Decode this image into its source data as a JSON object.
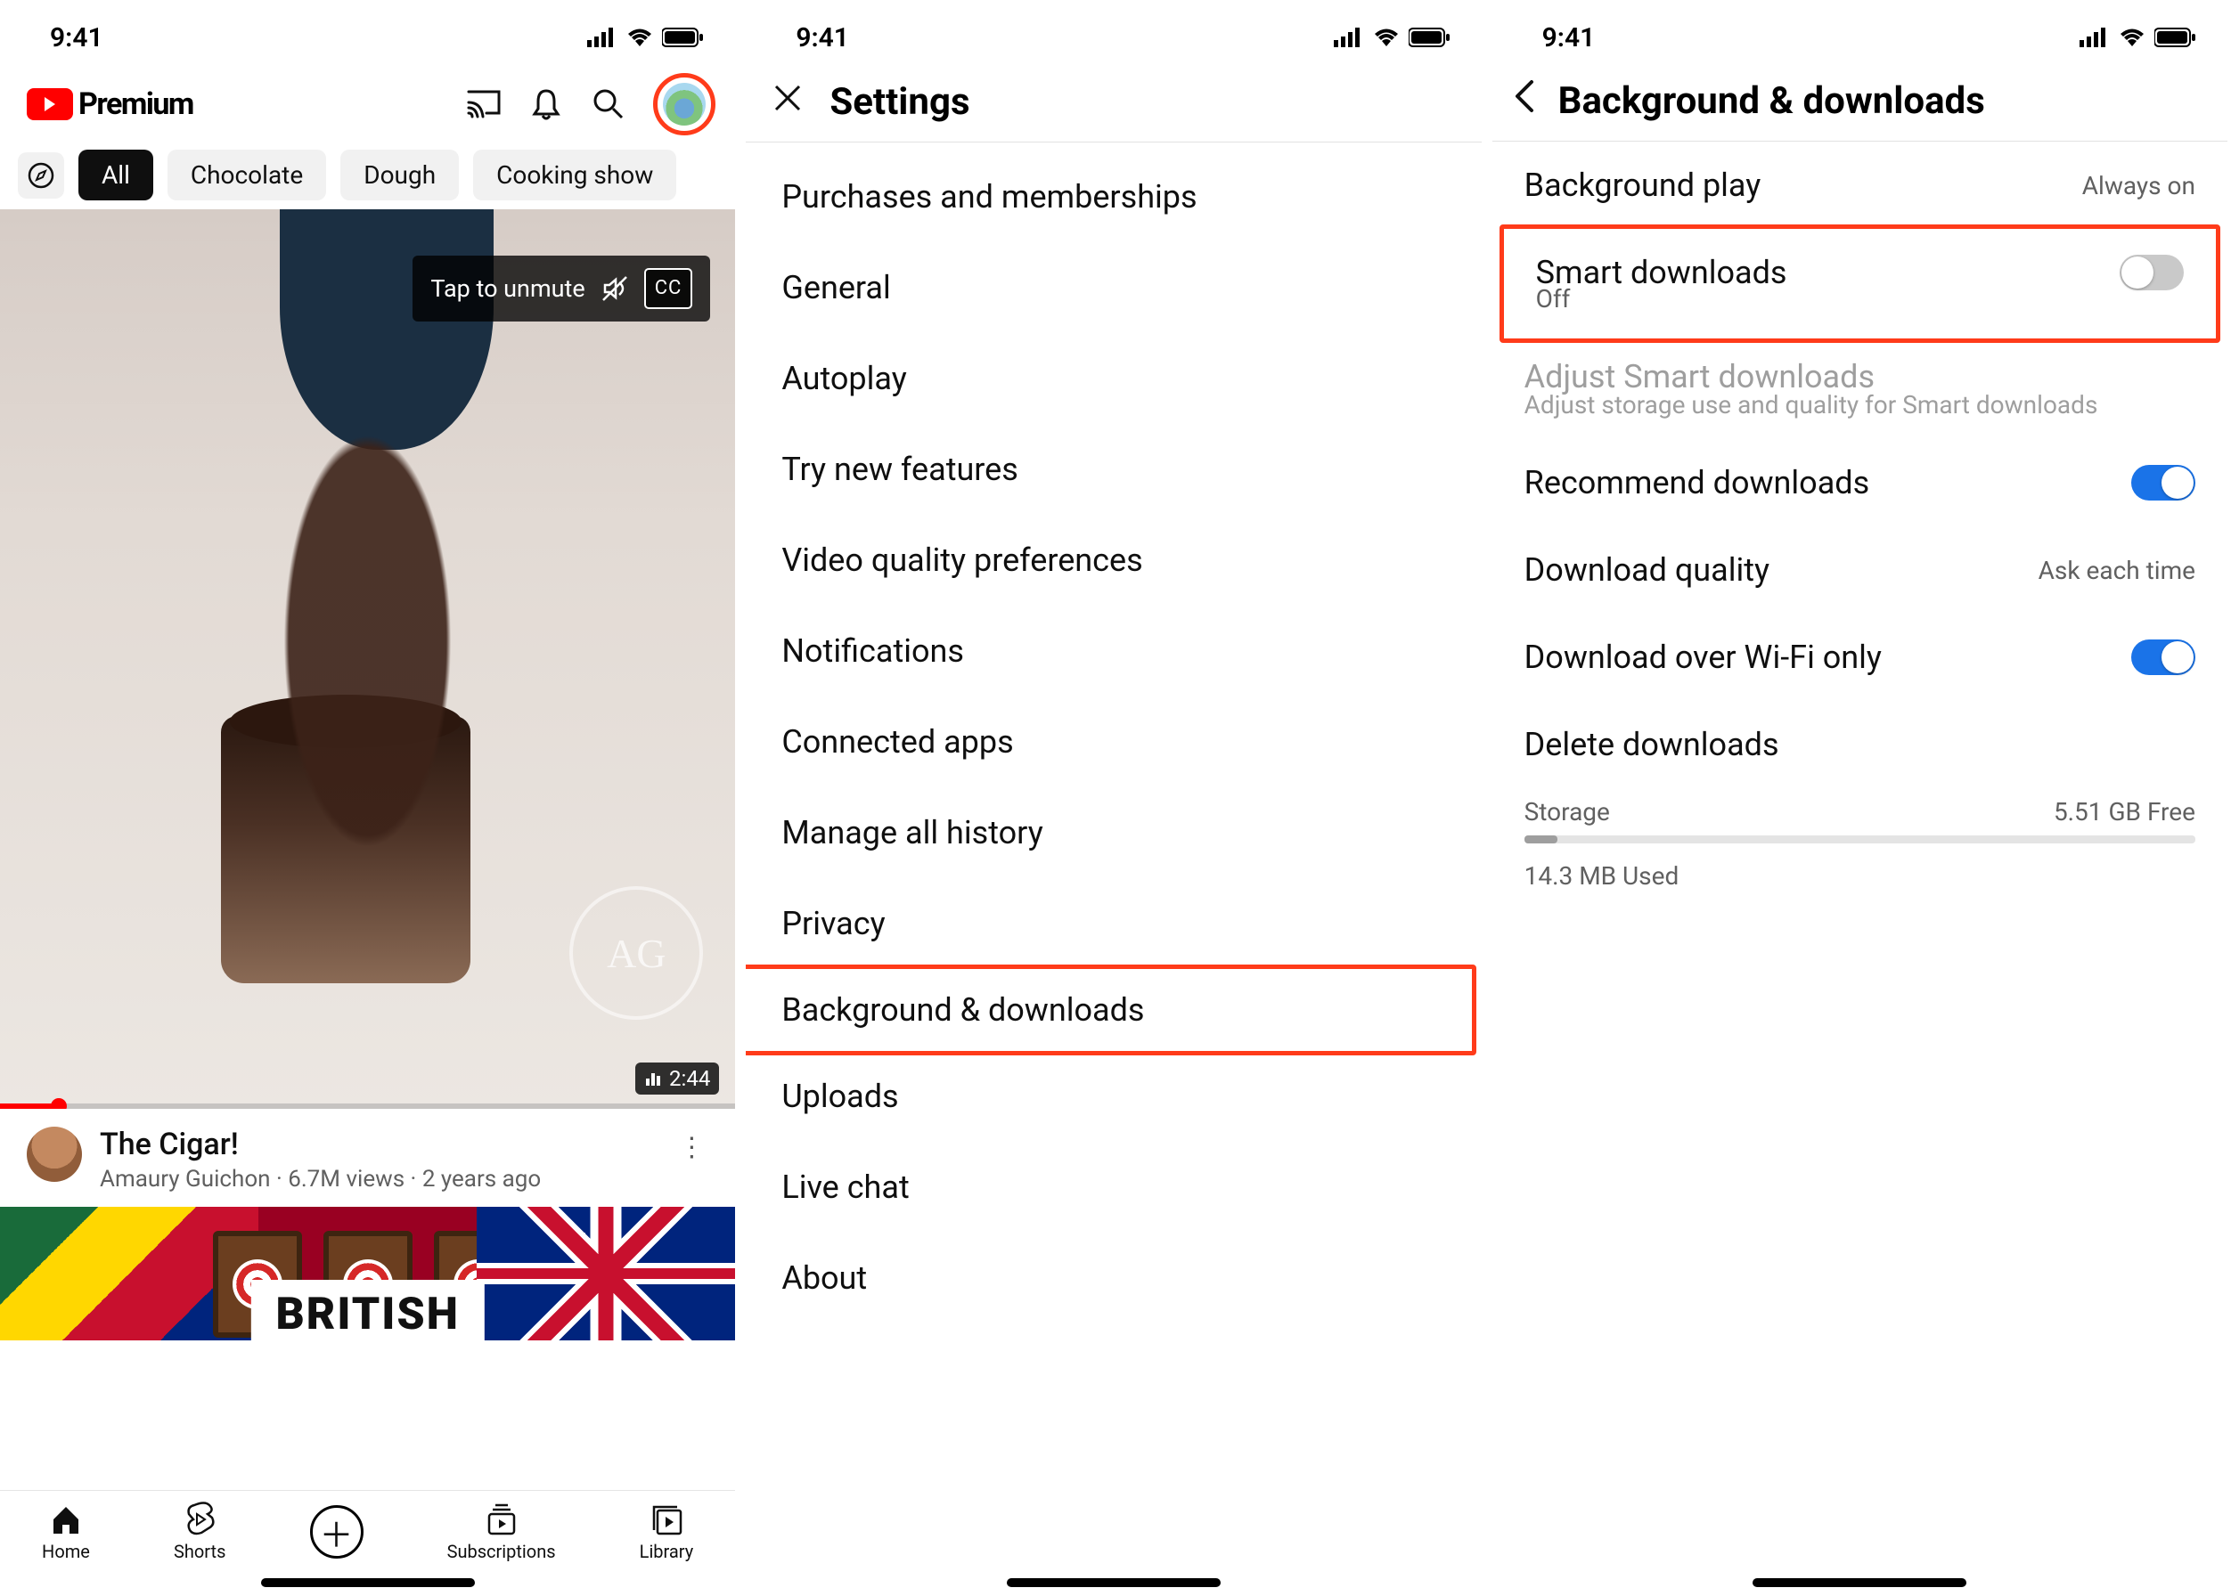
{
  "status": {
    "time": "9:41"
  },
  "screen1": {
    "logo_text": "Premium",
    "chips": {
      "all": "All",
      "c1": "Chocolate",
      "c2": "Dough",
      "c3": "Cooking show"
    },
    "unmute": "Tap to unmute",
    "cc": "CC",
    "duration": "2:44",
    "video": {
      "title": "The Cigar!",
      "channel": "Amaury Guichon",
      "views": "6.7M views",
      "age": "2 years ago"
    },
    "next_title": "BRITISH",
    "tabs": {
      "home": "Home",
      "shorts": "Shorts",
      "subs": "Subscriptions",
      "library": "Library"
    }
  },
  "screen2": {
    "title": "Settings",
    "items": {
      "purchases": "Purchases and memberships",
      "general": "General",
      "autoplay": "Autoplay",
      "try_new": "Try new features",
      "video_quality": "Video quality preferences",
      "notifications": "Notifications",
      "connected": "Connected apps",
      "history": "Manage all history",
      "privacy": "Privacy",
      "bgdl": "Background & downloads",
      "uploads": "Uploads",
      "live_chat": "Live chat",
      "about": "About"
    }
  },
  "screen3": {
    "title": "Background & downloads",
    "rows": {
      "bg_play": {
        "label": "Background play",
        "value": "Always on"
      },
      "smart": {
        "label": "Smart downloads",
        "sub": "Off"
      },
      "adjust": {
        "label": "Adjust Smart downloads",
        "sub": "Adjust storage use and quality for Smart downloads"
      },
      "recommend": "Recommend downloads",
      "quality": {
        "label": "Download quality",
        "value": "Ask each time"
      },
      "wifi": "Download over Wi-Fi only",
      "delete": "Delete downloads"
    },
    "storage": {
      "label": "Storage",
      "free": "5.51 GB Free",
      "used": "14.3 MB Used"
    }
  }
}
